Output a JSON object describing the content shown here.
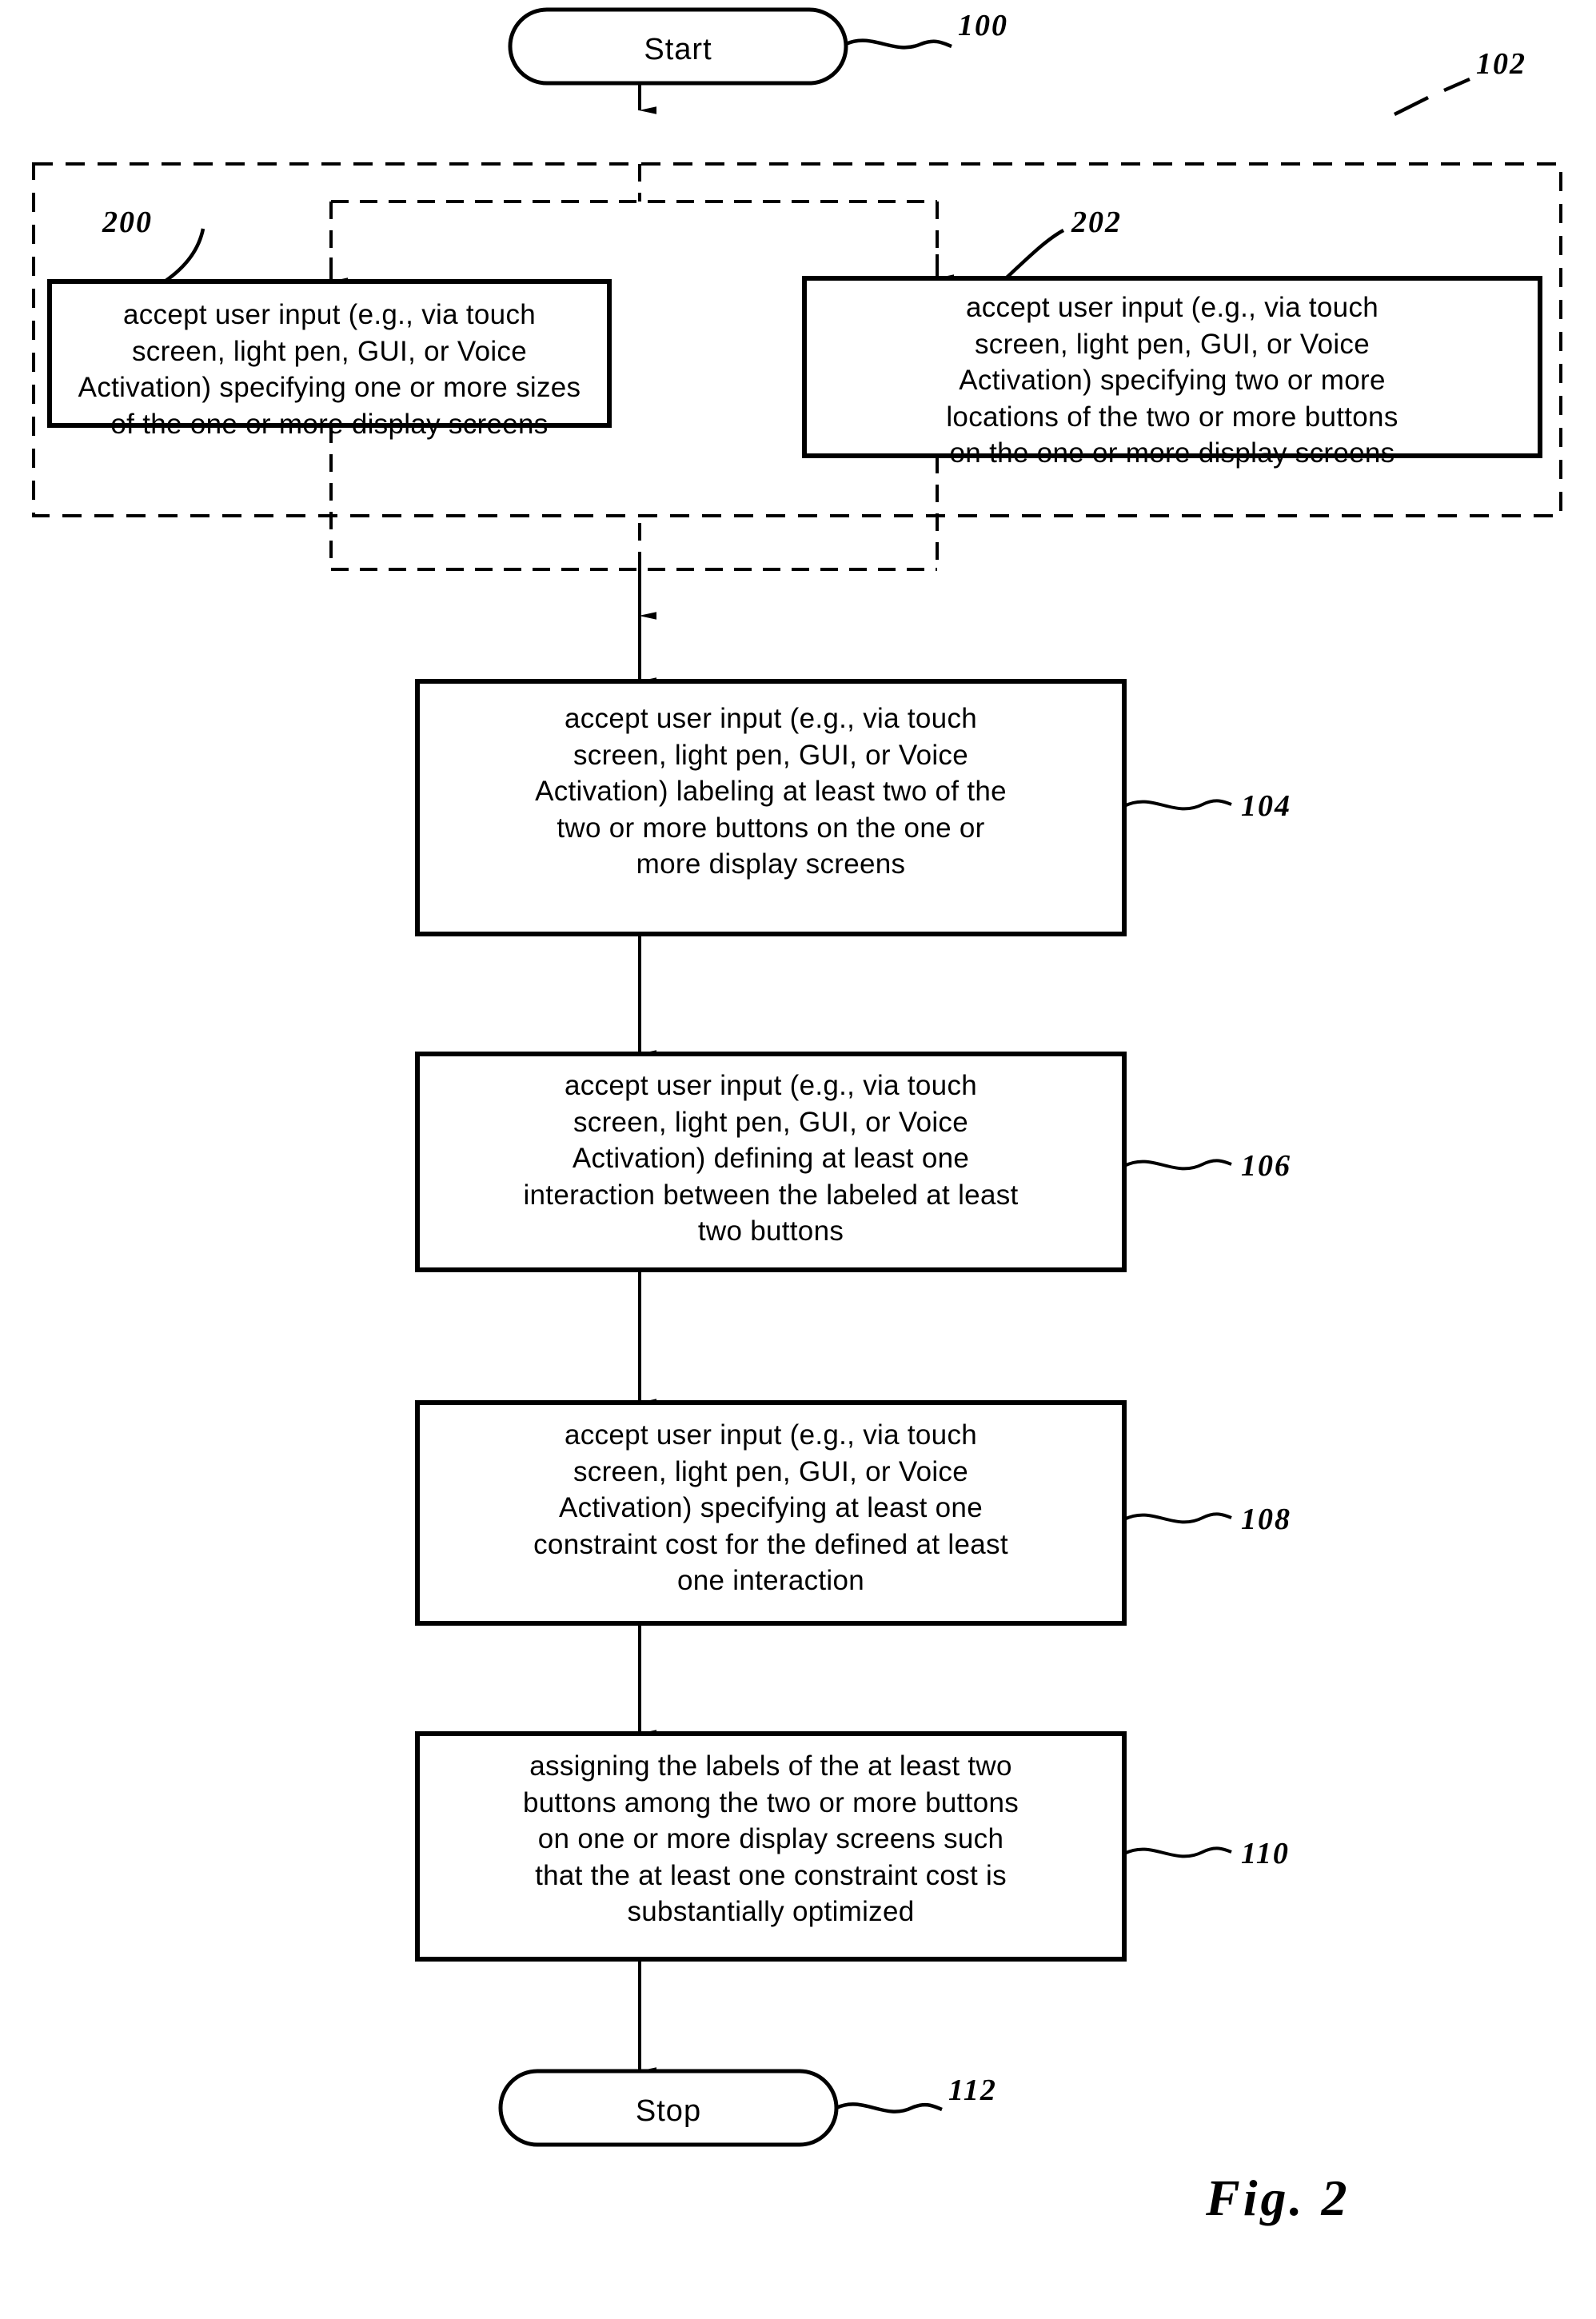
{
  "figure": {
    "caption": "Fig. 2",
    "type": "patent-flowchart"
  },
  "nodes": {
    "start": {
      "ref": "100",
      "label": "Start",
      "shape": "terminal"
    },
    "group": {
      "ref": "102",
      "shape": "dashed-group"
    },
    "step200": {
      "ref": "200",
      "label": "accept user input (e.g., via touch\nscreen, light pen, GUI, or Voice\nActivation) specifying one or more sizes\nof the one or more display screens",
      "shape": "process"
    },
    "step202": {
      "ref": "202",
      "label": "accept user input (e.g., via touch\nscreen, light pen, GUI, or Voice\nActivation) specifying two or more\nlocations of the two or more buttons\non the one or more display screens",
      "shape": "process"
    },
    "step104": {
      "ref": "104",
      "label": "accept user input (e.g., via touch\nscreen, light pen, GUI, or Voice\nActivation) labeling at least two of the\ntwo or more buttons on the one or\nmore display screens",
      "shape": "process"
    },
    "step106": {
      "ref": "106",
      "label": "accept user input (e.g., via touch\nscreen, light pen, GUI, or Voice\nActivation) defining at least one\ninteraction between the labeled at least\ntwo buttons",
      "shape": "process"
    },
    "step108": {
      "ref": "108",
      "label": "accept user input (e.g., via touch\nscreen, light pen, GUI, or Voice\nActivation) specifying at least one\nconstraint cost for the defined at least\none interaction",
      "shape": "process"
    },
    "step110": {
      "ref": "110",
      "label": "assigning the labels of the at least two\nbuttons among the two or more buttons\non one or more display screens such\nthat the at least one constraint cost is\nsubstantially optimized",
      "shape": "process"
    },
    "stop": {
      "ref": "112",
      "label": "Stop",
      "shape": "terminal"
    }
  },
  "colors": {
    "ink": "#000000",
    "paper": "#ffffff"
  }
}
